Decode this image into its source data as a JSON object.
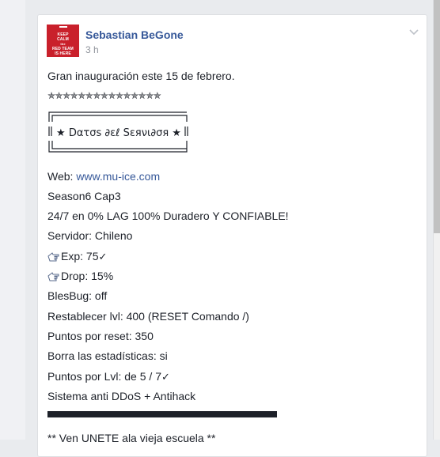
{
  "post": {
    "author": "Sebastian BeGone",
    "timestamp": "3 h",
    "avatar_text": [
      "KEEP",
      "CALM",
      "the",
      "RED TEAM",
      "IS HERE"
    ],
    "lines": {
      "intro": "Gran inauguración este 15 de febrero.",
      "stars": "✯✯✯✯✯✯✯✯✯✯✯✯✯✯✯",
      "frame_title": "★ Dατσs ∂εℓ Sεяνι∂σя ★",
      "web_label": "Web: ",
      "web_link": "www.mu-ice.com",
      "season": "Season6 Cap3",
      "uptime": "24/7 en 0% LAG 100% Duradero Y CONFIABLE!",
      "server": "Servidor: Chileno",
      "exp": "Exp: 75",
      "drop": "Drop: 15%",
      "blesbug": "BlesBug: off",
      "reset_level": "Restablecer lvl: 400 (RESET Comando /)",
      "reset_points": "Puntos por reset: 350",
      "stats": "Borra las estadísticas: si",
      "points_level": "Puntos por Lvl: de 5 / 7",
      "antihack": "Sistema anti DDoS + Antihack",
      "footer": "** Ven UNETE ala vieja escuela **"
    },
    "checkmark": "✓"
  },
  "colors": {
    "link": "#365899",
    "text": "#1d2129",
    "meta": "#90949c",
    "avatar_bg": "#c9202b"
  },
  "icons": {
    "hand": "pointing-hand-icon",
    "chevron": "chevron-down-icon"
  }
}
